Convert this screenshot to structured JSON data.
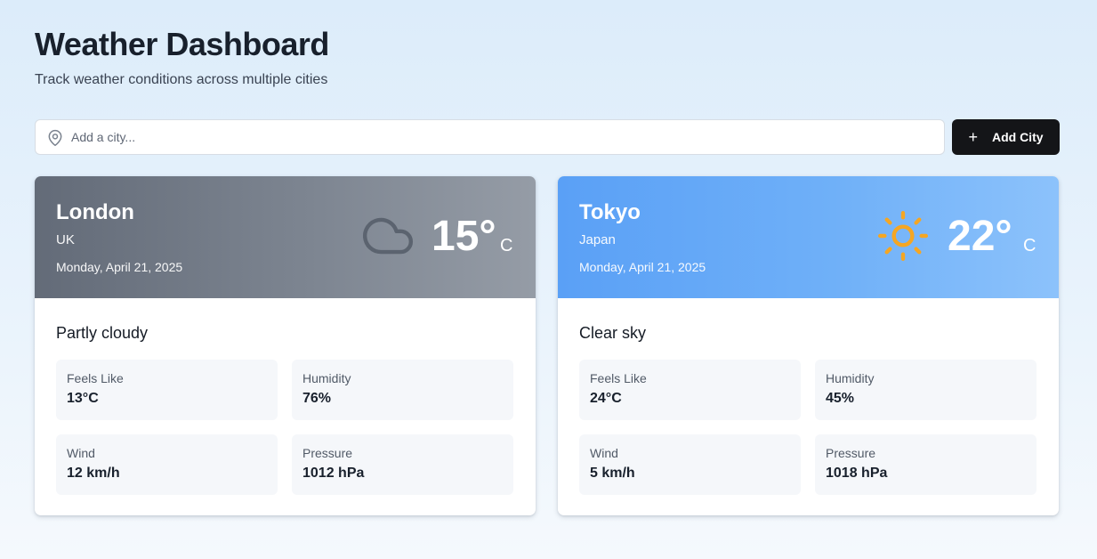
{
  "header": {
    "title": "Weather Dashboard",
    "subtitle": "Track weather conditions across multiple cities"
  },
  "search": {
    "placeholder": "Add a city...",
    "value": "",
    "icon": "map-pin-icon"
  },
  "add_button": {
    "label": "Add City",
    "icon": "plus-icon"
  },
  "cities": [
    {
      "city": "London",
      "country": "UK",
      "date": "Monday, April 21, 2025",
      "temperature": "15°",
      "unit": "C",
      "condition": "Partly cloudy",
      "icon": "cloud-icon",
      "theme_colors": [
        "#636b78",
        "#959ca6"
      ],
      "stats": {
        "feels_like_label": "Feels Like",
        "feels_like": "13°C",
        "humidity_label": "Humidity",
        "humidity": "76%",
        "wind_label": "Wind",
        "wind": "12 km/h",
        "pressure_label": "Pressure",
        "pressure": "1012 hPa"
      }
    },
    {
      "city": "Tokyo",
      "country": "Japan",
      "date": "Monday, April 21, 2025",
      "temperature": "22°",
      "unit": "C",
      "condition": "Clear sky",
      "icon": "sun-icon",
      "theme_colors": [
        "#5aa0f6",
        "#8cc2fb"
      ],
      "stats": {
        "feels_like_label": "Feels Like",
        "feels_like": "24°C",
        "humidity_label": "Humidity",
        "humidity": "45%",
        "wind_label": "Wind",
        "wind": "5 km/h",
        "pressure_label": "Pressure",
        "pressure": "1018 hPa"
      }
    }
  ],
  "colors": {
    "primary_button": "#141518",
    "sun": "#f5a623",
    "cloud_stroke": "#5b636f"
  }
}
